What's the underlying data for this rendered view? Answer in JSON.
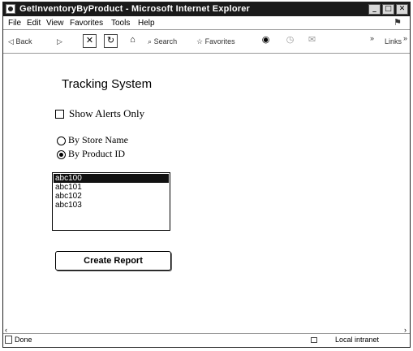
{
  "window": {
    "title": "GetInventoryByProduct - Microsoft Internet Explorer",
    "controls": {
      "minimize": "_",
      "maximize": "□",
      "close": "✕"
    }
  },
  "menubar": {
    "items": [
      "File",
      "Edit",
      "View",
      "Favorites",
      "Tools",
      "Help"
    ]
  },
  "toolbar": {
    "back_label": "Back",
    "search_label": "Search",
    "favorites_label": "Favorites",
    "links_label": "Links",
    "chevron": "»"
  },
  "main": {
    "heading": "Tracking System",
    "show_alerts_label": "Show Alerts Only",
    "show_alerts_checked": false,
    "radios": [
      {
        "label": "By Store Name",
        "checked": false
      },
      {
        "label": "By Product ID",
        "checked": true
      }
    ],
    "listbox": {
      "items": [
        "abc100",
        "abc101",
        "abc102",
        "abc103"
      ],
      "selected_index": 0
    },
    "create_report_label": "Create Report"
  },
  "statusbar": {
    "status": "Done",
    "zone": "Local intranet"
  }
}
